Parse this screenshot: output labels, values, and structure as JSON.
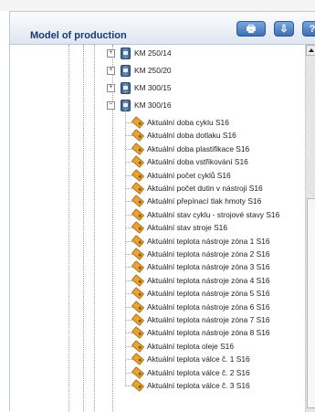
{
  "panel": {
    "title": "Model of production",
    "buttons": [
      {
        "name": "print-icon",
        "glyph": "🖶"
      },
      {
        "name": "pin-icon",
        "glyph": "⇩"
      },
      {
        "name": "help-icon",
        "glyph": "?"
      }
    ]
  },
  "tree": {
    "machines": [
      {
        "label": "KM 250/14",
        "expanded": false
      },
      {
        "label": "KM 250/20",
        "expanded": false
      },
      {
        "label": "KM 300/15",
        "expanded": false
      },
      {
        "label": "KM 300/16",
        "expanded": true
      }
    ],
    "tags": [
      "Aktuální doba cyklu S16",
      "Aktuální doba dotlaku S16",
      "Aktuální doba plastifikace S16",
      "Aktuální doba vstřikování S16",
      "Aktuální počet cyklů S16",
      "Aktuální počet dutin v nástroji S16",
      "Aktuální přepínací tlak hmoty S16",
      "Aktuální stav cyklu - strojové stavy S16",
      "Aktuální stav stroje S16",
      "Aktuální teplota nástroje zóna 1 S16",
      "Aktuální teplota nástroje zóna 2 S16",
      "Aktuální teplota nástroje zóna 3 S16",
      "Aktuální teplota nástroje zóna 4 S16",
      "Aktuální teplota nástroje zóna 5 S16",
      "Aktuální teplota nástroje zóna 6 S16",
      "Aktuální teplota nástroje zóna 7 S16",
      "Aktuální teplota nástroje zóna 8 S16",
      "Aktuální teplota oleje S16",
      "Aktuální teplota válce č. 1 S16",
      "Aktuální teplota válce č. 2 S16",
      "Aktuální teplota válce č. 3 S16"
    ]
  }
}
